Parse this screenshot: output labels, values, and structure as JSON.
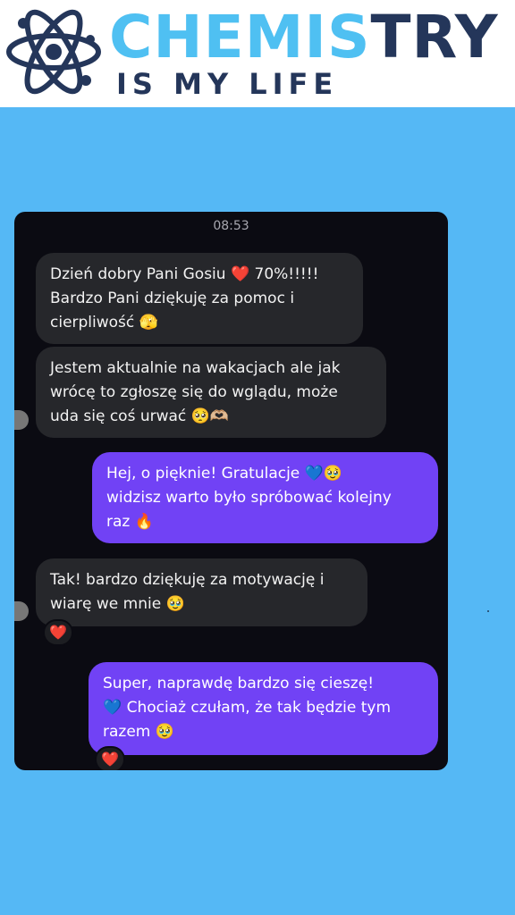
{
  "brand": {
    "title_part1": "CHEMIS",
    "title_part2": "TRY",
    "subtitle": "IS MY LIFE",
    "accent_light": "#4fc0f2",
    "accent_dark": "#24365a",
    "icon": "atom-icon"
  },
  "chat": {
    "timestamp": "08:53",
    "messages": [
      {
        "direction": "incoming",
        "lines": [
          "Dzień dobry Pani Gosiu ❤️ 70%!!!!!",
          "Bardzo Pani dziękuję za pomoc i",
          "cierpliwość 🫣"
        ]
      },
      {
        "direction": "incoming",
        "lines": [
          "Jestem aktualnie na wakacjach ale jak",
          "wrócę to zgłoszę się do wglądu, może",
          "uda się coś urwać 🥺🫶🏼"
        ]
      },
      {
        "direction": "outgoing",
        "lines": [
          "Hej, o pięknie! Gratulacje 💙🥹",
          "widzisz warto było spróbować kolejny",
          "raz 🔥"
        ]
      },
      {
        "direction": "incoming",
        "lines": [
          "Tak! bardzo dziękuję za motywację i",
          "wiarę we mnie 🥹"
        ],
        "reaction": "❤️"
      },
      {
        "direction": "outgoing",
        "lines": [
          "Super, naprawdę bardzo się cieszę!",
          "💙 Chociaż czułam, że tak będzie tym",
          "razem 🥹"
        ],
        "reaction": "❤️"
      }
    ]
  },
  "colors": {
    "page_background": "#55b8f5",
    "chat_background": "#0b0b12",
    "incoming_bubble": "#26272b",
    "outgoing_bubble": "#7142f5",
    "reaction_heart": "#e8203a"
  }
}
